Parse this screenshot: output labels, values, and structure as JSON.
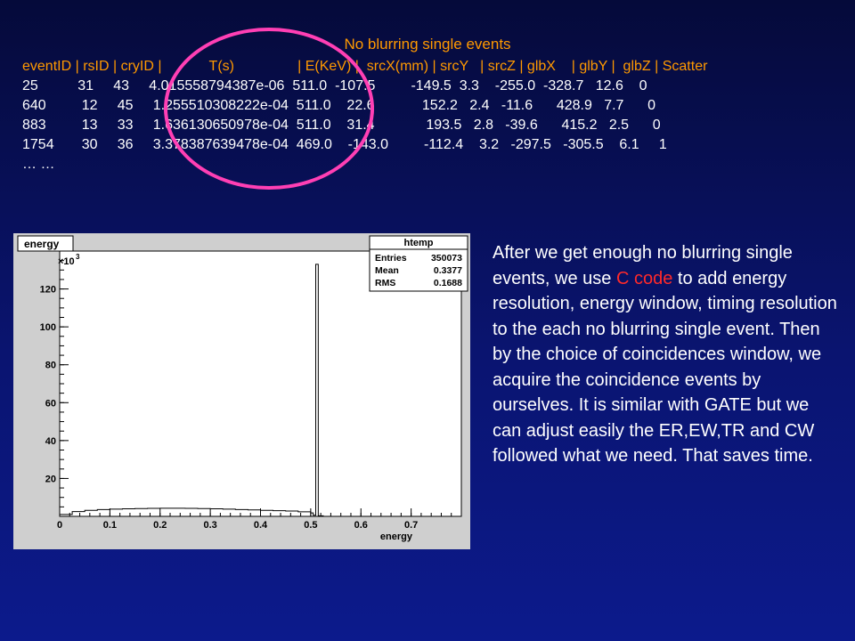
{
  "title": "No blurring single events",
  "header": "eventID | rsID | cryID |            T(s)                | E(KeV) |  srcX(mm) | srcY   | srcZ | glbX    | glbY |  glbZ | Scatter",
  "rows": [
    "25          31     43     4.015558794387e-06  511.0  -107.5         -149.5  3.3    -255.0  -328.7   12.6    0",
    "640         12     45     1.255510308222e-04  511.0    22.6            152.2   2.4   -11.6      428.9   7.7      0",
    "883         13     33     1.636130650978e-04  511.0    31.4             193.5   2.8   -39.6      415.2   2.5      0",
    "1754       30     36     3.378387639478e-04  469.0    -143.0         -112.4    3.2   -297.5   -305.5    6.1     1",
    "… …"
  ],
  "paragraph": {
    "before": "After we get enough no blurring single events, we use ",
    "highlight": "C code",
    "after": " to add energy resolution, energy window, timing resolution to the each no blurring single event. Then by the choice of coincidences window, we acquire the coincidence events by ourselves. It is similar with GATE but we can adjust easily the ER,EW,TR and CW followed what we need. That saves time."
  },
  "colors": {
    "header": "#ff9900",
    "highlight": "#ff2a2a",
    "oval": "#ff3fb4"
  },
  "chart_data": {
    "type": "histogram",
    "canvas_label": "energy",
    "xlabel": "energy",
    "ylabel": "",
    "y_multiplier": "×10",
    "y_exponent": "3",
    "xlim": [
      0,
      0.8
    ],
    "ylim": [
      0,
      140
    ],
    "x_ticks": [
      "0",
      "0.1",
      "0.2",
      "0.3",
      "0.4",
      "0.5",
      "0.6",
      "0.7"
    ],
    "y_ticks": [
      "20",
      "40",
      "60",
      "80",
      "100",
      "120"
    ],
    "stats": {
      "name": "htemp",
      "entries_label": "Entries",
      "entries": "350073",
      "mean_label": "Mean",
      "mean": "0.3377",
      "rms_label": "RMS",
      "rms": "0.1688"
    },
    "x": [
      0.0,
      0.025,
      0.05,
      0.075,
      0.1,
      0.125,
      0.15,
      0.175,
      0.2,
      0.225,
      0.25,
      0.275,
      0.3,
      0.325,
      0.35,
      0.375,
      0.4,
      0.425,
      0.45,
      0.475,
      0.5,
      0.505,
      0.51,
      0.515,
      0.525
    ],
    "values": [
      1.0,
      2.5,
      3.2,
      3.6,
      3.8,
      4.0,
      4.1,
      4.2,
      4.3,
      4.3,
      4.2,
      4.1,
      4.0,
      3.8,
      3.6,
      3.4,
      3.2,
      3.0,
      2.8,
      2.4,
      1.8,
      0.6,
      133,
      0.3,
      0
    ]
  }
}
